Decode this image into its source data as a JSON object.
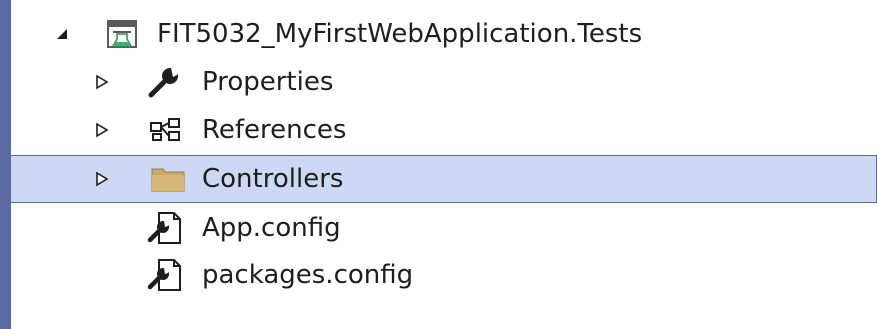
{
  "tree": {
    "project": {
      "label": "FIT5032_MyFirstWebApplication.Tests",
      "expanded": true,
      "icon": "test-project-icon"
    },
    "items": [
      {
        "label": "Properties",
        "icon": "wrench-icon",
        "expandable": true,
        "selected": false
      },
      {
        "label": "References",
        "icon": "references-icon",
        "expandable": true,
        "selected": false
      },
      {
        "label": "Controllers",
        "icon": "folder-icon",
        "expandable": true,
        "selected": true
      },
      {
        "label": "App.config",
        "icon": "config-file-icon",
        "expandable": false,
        "selected": false
      },
      {
        "label": "packages.config",
        "icon": "config-file-icon",
        "expandable": false,
        "selected": false
      }
    ]
  },
  "colors": {
    "selection_bg": "#cdd8f4",
    "selection_border": "#5e6c9a",
    "left_bar": "#5b6aa0",
    "folder": "#c8a96b",
    "text": "#1e1e1e"
  }
}
